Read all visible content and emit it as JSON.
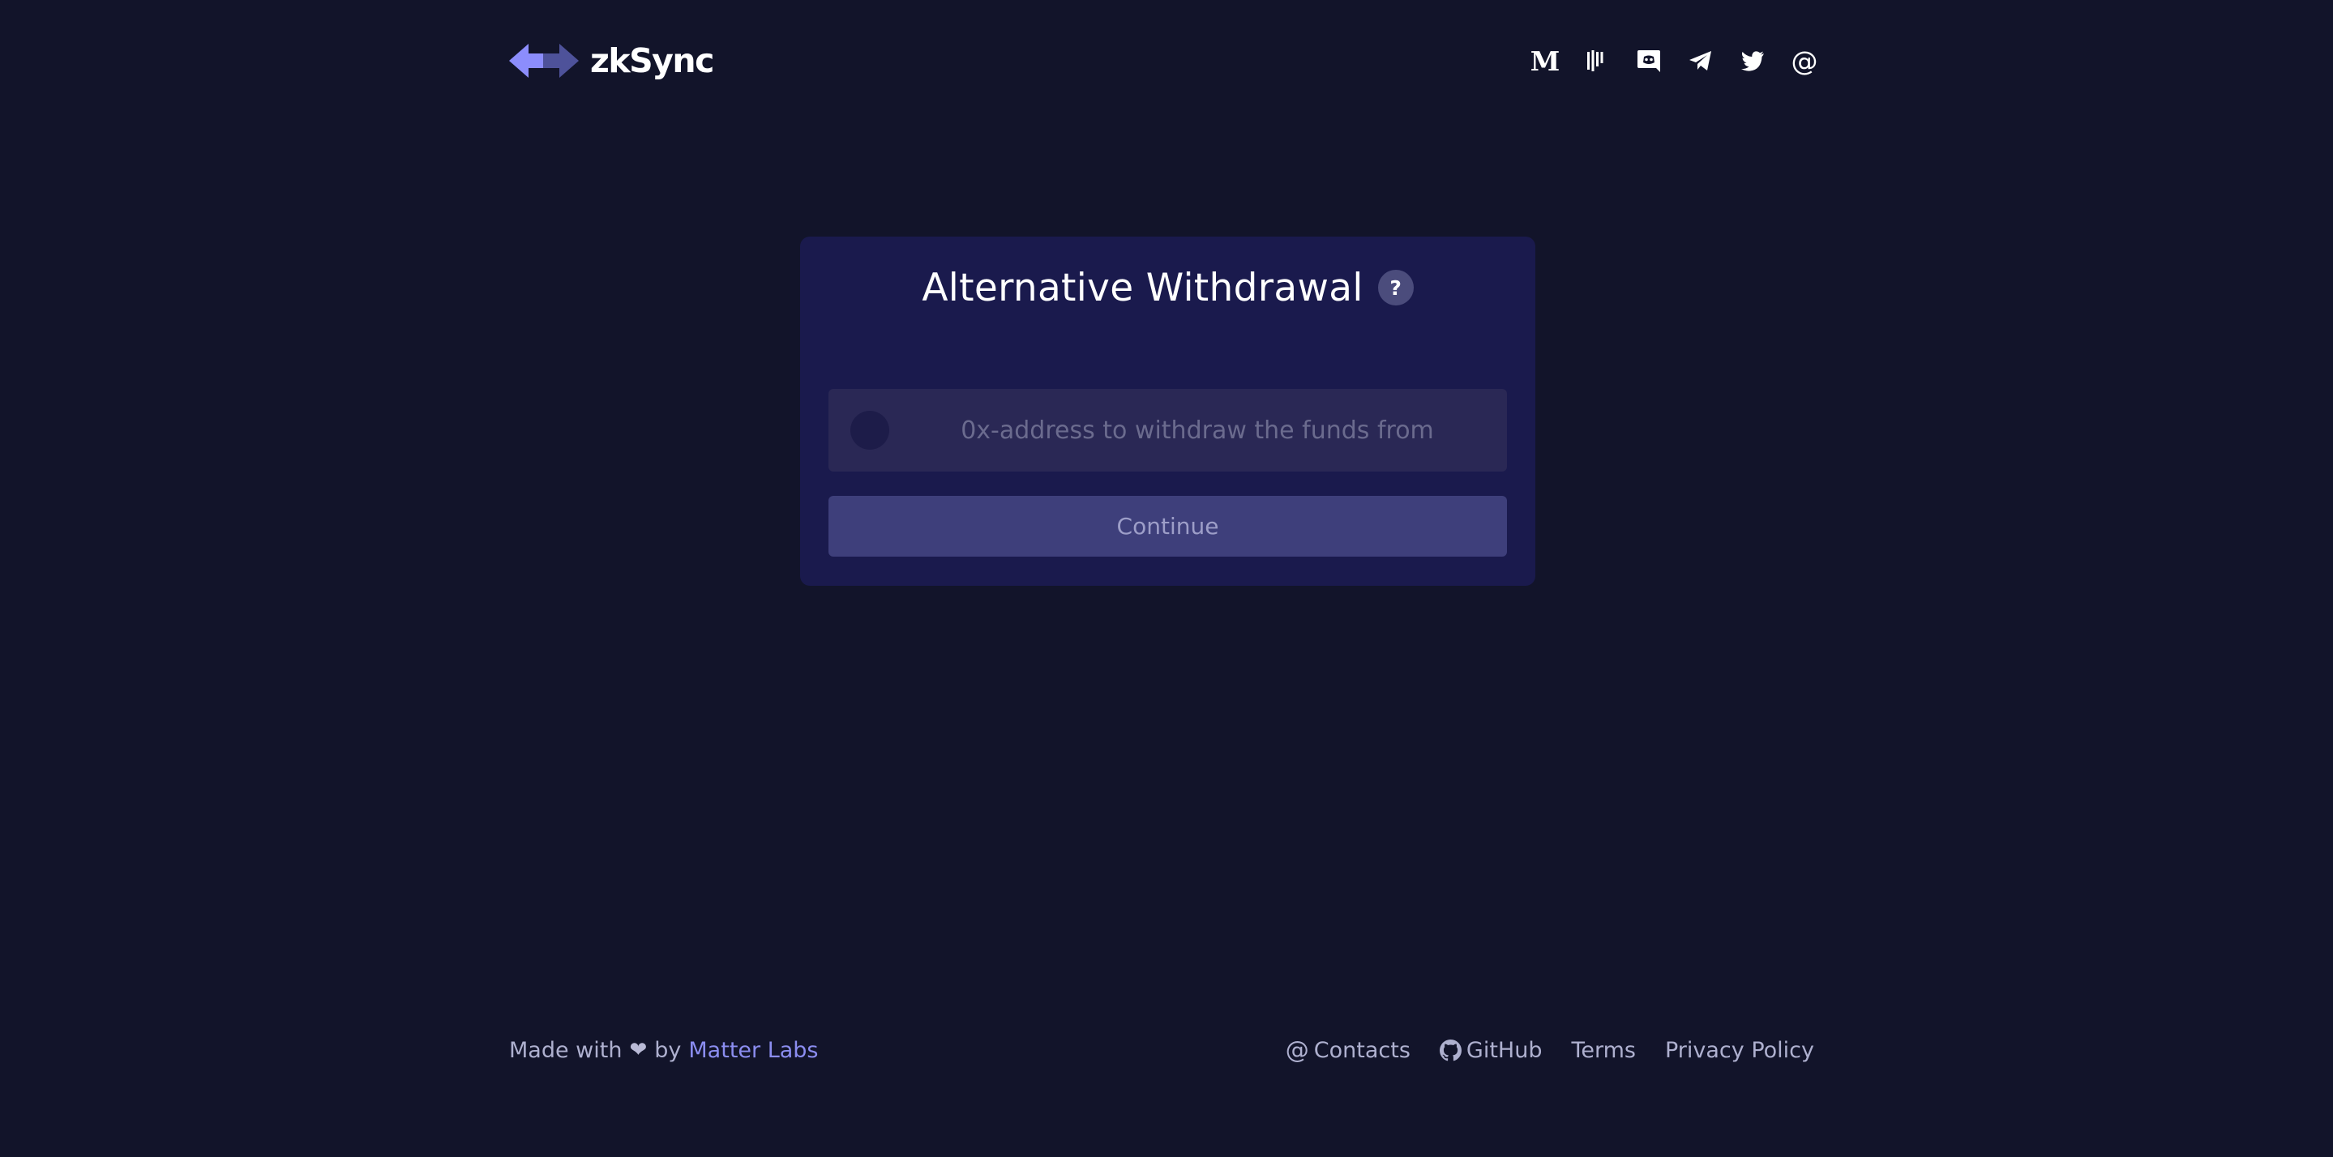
{
  "header": {
    "logo_text": "zkSync",
    "socials": [
      {
        "name": "medium-icon",
        "glyph": "M"
      },
      {
        "name": "gitcoin-icon"
      },
      {
        "name": "discord-icon"
      },
      {
        "name": "telegram-icon"
      },
      {
        "name": "twitter-icon"
      },
      {
        "name": "email-icon",
        "glyph": "@"
      }
    ]
  },
  "card": {
    "title": "Alternative Withdrawal",
    "help_glyph": "?",
    "address_placeholder": "0x-address to withdraw the funds from",
    "address_value": "",
    "continue_label": "Continue"
  },
  "footer": {
    "made_with": "Made with",
    "heart": "❤",
    "by": "by",
    "matter_labs": "Matter Labs",
    "contacts_glyph": "@",
    "contacts": "Contacts",
    "github": "GitHub",
    "terms": "Terms",
    "privacy": "Privacy Policy"
  },
  "colors": {
    "background": "#12142a",
    "card": "#1a1a4d",
    "input": "#2a2855",
    "button": "#3e3f7b",
    "accent": "#8b8df0",
    "logo_primary": "#8c8dfc",
    "logo_secondary": "#4e529a"
  }
}
